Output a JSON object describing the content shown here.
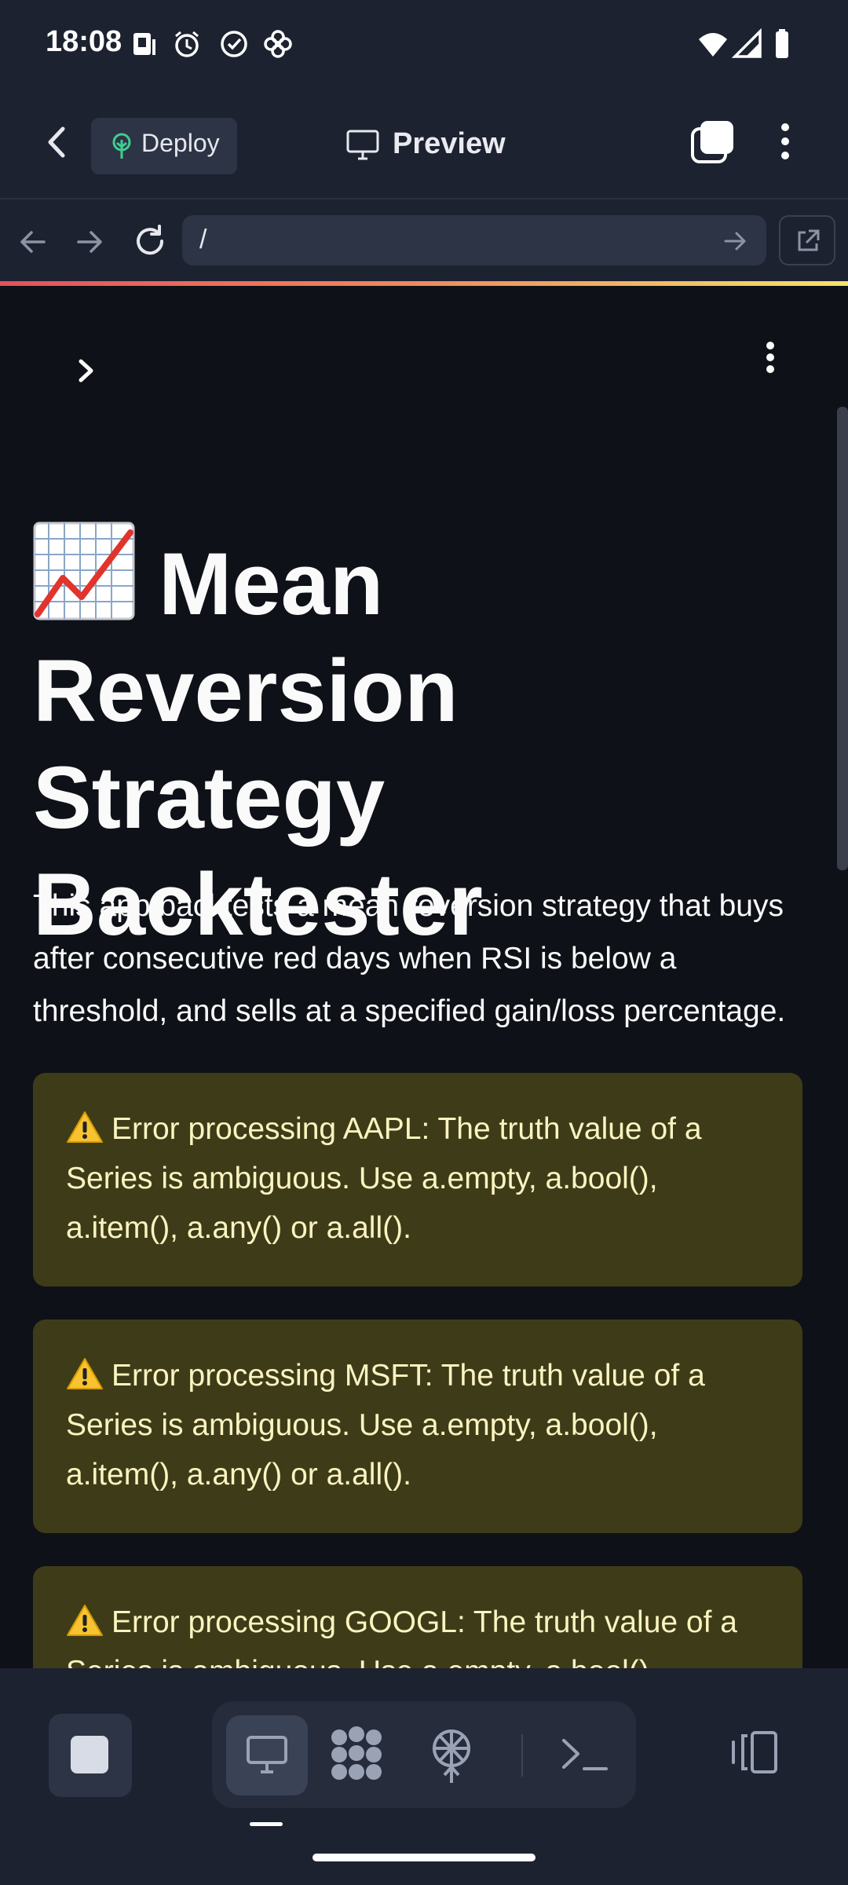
{
  "status_bar": {
    "time": "18:08",
    "left_icons": [
      "sim-card-icon",
      "alarm-icon",
      "check-circle-icon",
      "pinwheel-icon"
    ],
    "right_icons": [
      "wifi-icon",
      "signal-icon",
      "battery-icon"
    ]
  },
  "app_bar": {
    "back_icon": "back-arrow-icon",
    "deploy_label": "Deploy",
    "deploy_icon": "tree-icon",
    "preview_label": "Preview",
    "preview_icon": "monitor-icon",
    "tabs_icon": "tabs-icon",
    "more_icon": "more-vert-icon"
  },
  "url_bar": {
    "url": "/",
    "nav_icons": [
      "nav-back-icon",
      "nav-forward-icon",
      "reload-icon"
    ],
    "go_icon": "go-arrow-icon",
    "open_external_icon": "open-external-icon"
  },
  "page": {
    "sidebar_toggle_icon": "chevron-right-icon",
    "menu_icon": "more-vert-icon",
    "title_emoji": "chart-increasing-icon",
    "title": "Mean Reversion Strategy Backtester",
    "intro": "This app backtests a mean reversion strategy that buys after consecutive red days when RSI is below a threshold, and sells at a specified gain/loss percentage.",
    "alerts": [
      {
        "icon": "warning-icon",
        "text": "Error processing AAPL: The truth value of a Series is ambiguous. Use a.empty, a.bool(), a.item(), a.any() or a.all()."
      },
      {
        "icon": "warning-icon",
        "text": "Error processing MSFT: The truth value of a Series is ambiguous. Use a.empty, a.bool(), a.item(), a.any() or a.all()."
      },
      {
        "icon": "warning-icon",
        "text": "Error processing GOOGL: The truth value of a Series is ambiguous. Use a.empty, a.bool(), a.item(), a.any() or a.all()."
      }
    ]
  },
  "bottom_bar": {
    "stop_icon": "stop-icon",
    "views": [
      "desktop-icon",
      "brain-icon",
      "network-icon",
      "terminal-icon"
    ],
    "active_view": "desktop-icon",
    "layout_icon": "layout-toggle-icon"
  },
  "colors": {
    "chrome_bg": "#1d2230",
    "content_bg": "#0e1117",
    "alert_bg": "#3e3c18",
    "alert_text": "#fbf4c1",
    "accent_line": [
      "#e4515b",
      "#f08a5d",
      "#f4e36b"
    ]
  }
}
